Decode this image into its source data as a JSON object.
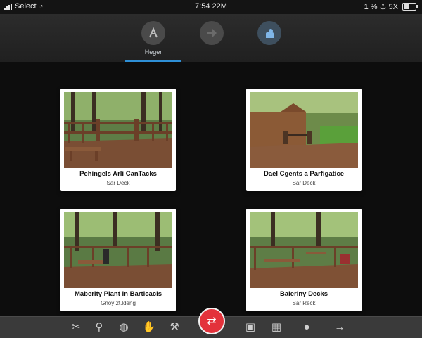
{
  "status_bar": {
    "carrier": "Select",
    "time": "7:54 22M",
    "right_text": "1 % ⚓ 5X",
    "battery_level": 0.55
  },
  "top_nav": {
    "tabs": [
      {
        "icon": "compass-icon",
        "glyph": "A",
        "label": "Heger",
        "active": false
      },
      {
        "icon": "forward-arrow-icon",
        "glyph": "➡",
        "label": "",
        "active": false
      },
      {
        "icon": "person-icon",
        "glyph": "✋",
        "label": "",
        "active": true
      }
    ],
    "indicator_label": "Heger"
  },
  "cards": [
    {
      "title": "Pehingels Arli CanTacks",
      "subtitle": "Sar Deck"
    },
    {
      "title": "Dael Cgents a Parfigatice",
      "subtitle": "Sar Deck"
    },
    {
      "title": "Maberity Plant in Barticacls",
      "subtitle": "Gnoy 2t.ldeng"
    },
    {
      "title": "Baleriny Decks",
      "subtitle": "Sar Reck"
    }
  ],
  "toolbar": {
    "icons": [
      "tools-icon",
      "location-pin-icon",
      "globe-icon",
      "hand-icon",
      "wrench-icon",
      "share-icon",
      "camera-icon",
      "calendar-icon",
      "apple-icon",
      "arrow-right-icon"
    ],
    "fab_icon": "swap-icon"
  },
  "colors": {
    "accent": "#2e8fd6",
    "fab": "#e3323b",
    "background": "#0d0d0d"
  }
}
